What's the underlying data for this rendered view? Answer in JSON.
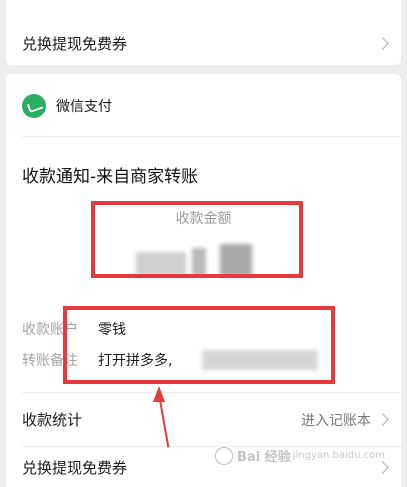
{
  "top_card": {
    "redeem_label": "兑换提现免费券"
  },
  "main_card": {
    "header_title": "微信支付",
    "notice_title": "收款通知-来自商家转账",
    "amount_label": "收款金额",
    "account_key": "收款账户",
    "account_value": "零钱",
    "remark_key": "转账备注",
    "remark_value": "打开拼多多,",
    "stats_label": "收款统计",
    "stats_action": "进入记账本",
    "redeem_label": "兑换提现免费券"
  },
  "watermark": {
    "text": "Bai 经验",
    "sub": "jingyan.baidu.com"
  },
  "colors": {
    "wechat_green": "#2aae67",
    "annotation_red": "#e8393a"
  }
}
